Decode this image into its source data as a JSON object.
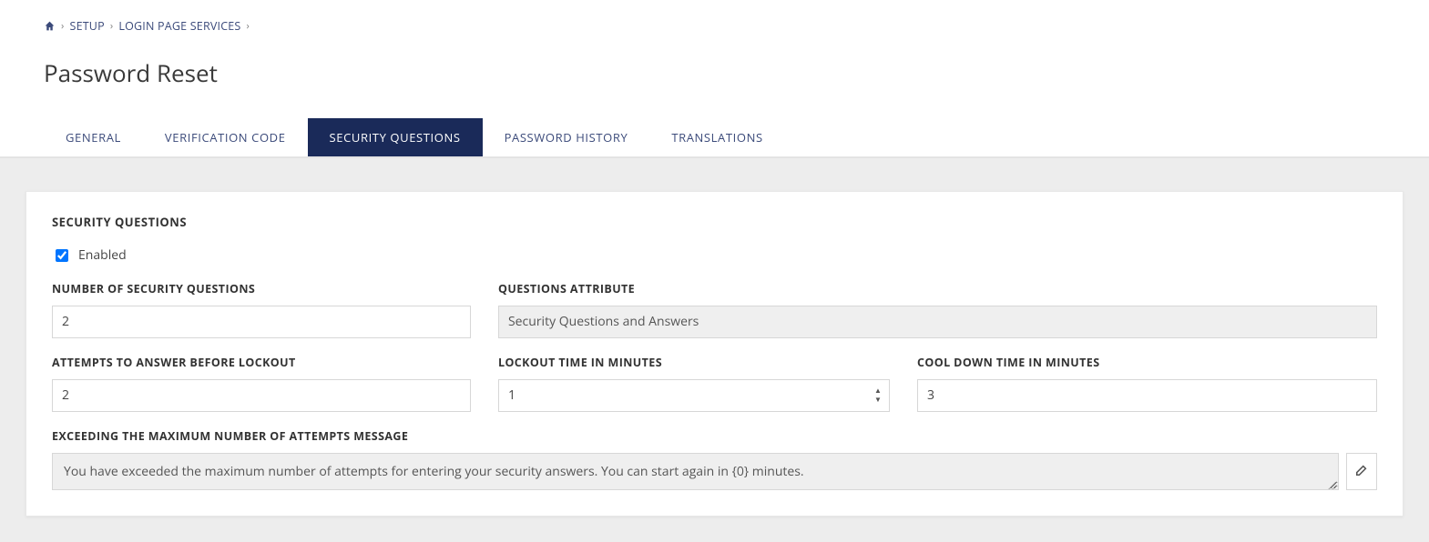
{
  "breadcrumb": {
    "setup": "SETUP",
    "login_page_services": "LOGIN PAGE SERVICES"
  },
  "page_title": "Password Reset",
  "tabs": {
    "general": "GENERAL",
    "verification_code": "VERIFICATION CODE",
    "security_questions": "SECURITY QUESTIONS",
    "password_history": "PASSWORD HISTORY",
    "translations": "TRANSLATIONS"
  },
  "section": {
    "title": "SECURITY QUESTIONS",
    "enabled_label": "Enabled",
    "enabled_checked": true,
    "fields": {
      "num_questions": {
        "label": "NUMBER OF SECURITY QUESTIONS",
        "value": "2"
      },
      "questions_attribute": {
        "label": "QUESTIONS ATTRIBUTE",
        "value": "Security Questions and Answers"
      },
      "attempts_before_lockout": {
        "label": "ATTEMPTS TO ANSWER BEFORE LOCKOUT",
        "value": "2"
      },
      "lockout_minutes": {
        "label": "LOCKOUT TIME IN MINUTES",
        "value": "1"
      },
      "cooldown_minutes": {
        "label": "COOL DOWN TIME IN MINUTES",
        "value": "3"
      },
      "exceed_message": {
        "label": "EXCEEDING THE MAXIMUM NUMBER OF ATTEMPTS MESSAGE",
        "value": "You have exceeded the maximum number of attempts for entering your security answers. You can start again in {0} minutes."
      }
    }
  }
}
